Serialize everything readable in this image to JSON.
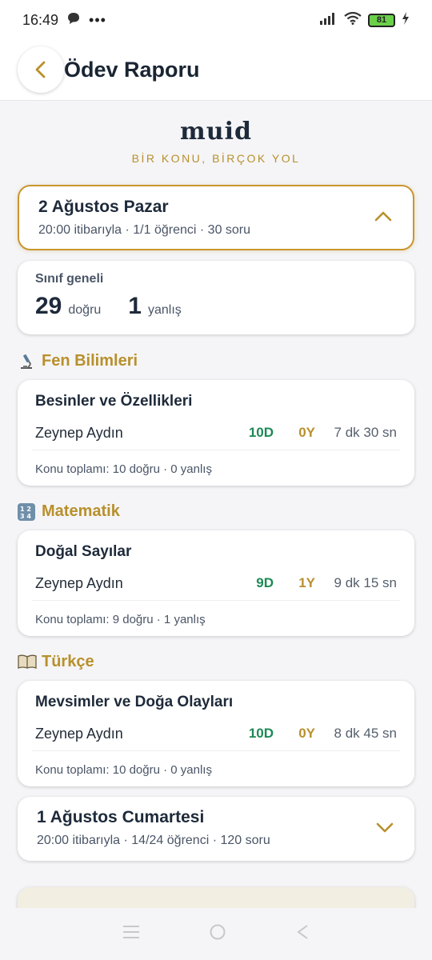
{
  "status_bar": {
    "time": "16:49",
    "battery": "81"
  },
  "header": {
    "title": "Ödev Raporu"
  },
  "logo": {
    "name": "muid",
    "tagline": "BİR KONU, BİRÇOK YOL"
  },
  "report_days": [
    {
      "title": "2 Ağustos Pazar",
      "subtitle": "20:00 itibarıyla · 1/1 öğrenci · 30 soru",
      "expanded": true
    },
    {
      "title": "1 Ağustos Cumartesi",
      "subtitle": "20:00 itibarıyla · 14/24 öğrenci · 120 soru",
      "expanded": false
    }
  ],
  "class_summary": {
    "label": "Sınıf geneli",
    "correct_count": "29",
    "correct_label": "doğru",
    "wrong_count": "1",
    "wrong_label": "yanlış"
  },
  "subjects": [
    {
      "name": "Fen Bilimleri",
      "icon": "microscope-icon",
      "topic": "Besinler ve Özellikleri",
      "student": "Zeynep Aydın",
      "correct": "10D",
      "wrong": "0Y",
      "time": "7 dk 30 sn",
      "total": "Konu toplamı: 10 doğru · 0 yanlış"
    },
    {
      "name": "Matematik",
      "icon": "numbers-icon",
      "topic": "Doğal Sayılar",
      "student": "Zeynep Aydın",
      "correct": "9D",
      "wrong": "1Y",
      "time": "9 dk 15 sn",
      "total": "Konu toplamı: 9 doğru · 1 yanlış"
    },
    {
      "name": "Türkçe",
      "icon": "open-book-icon",
      "topic": "Mevsimler ve Doğa Olayları",
      "student": "Zeynep Aydın",
      "correct": "10D",
      "wrong": "0Y",
      "time": "8 dk 45 sn",
      "total": "Konu toplamı: 10 doğru · 0 yanlış"
    }
  ],
  "colors": {
    "accent": "#b8902c",
    "correct": "#1d8a55",
    "text": "#1e2a3a",
    "background": "#f5f5f7"
  }
}
